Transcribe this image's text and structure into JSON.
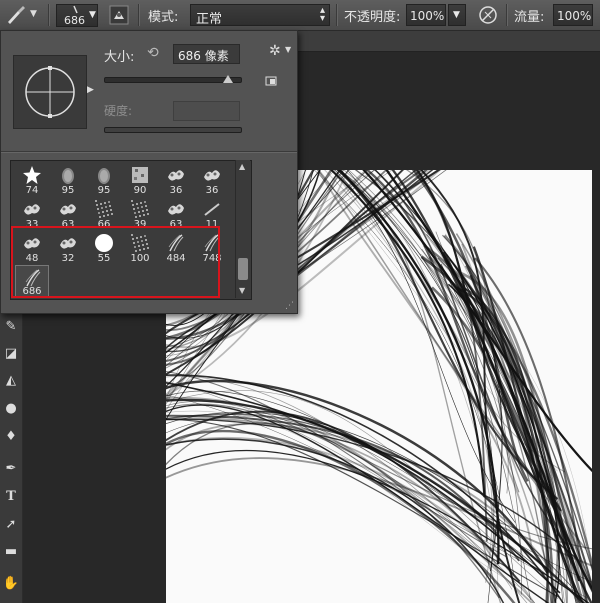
{
  "options_bar": {
    "brush_size": "686",
    "mode_label": "模式:",
    "mode_value": "正常",
    "opacity_label": "不透明度:",
    "opacity_value": "100%",
    "flow_label": "流量:",
    "flow_value": "100%"
  },
  "brush_panel": {
    "size_label": "大小:",
    "size_value": "686 像素",
    "hardness_label": "硬度:",
    "hardness_value": ""
  },
  "brushes": [
    {
      "size": "74",
      "icon": "star-brush-icon"
    },
    {
      "size": "95",
      "icon": "soft-drop-brush-icon"
    },
    {
      "size": "95",
      "icon": "soft-drop-brush-icon"
    },
    {
      "size": "90",
      "icon": "texture-brush-icon"
    },
    {
      "size": "36",
      "icon": "scatter-brush-icon"
    },
    {
      "size": "36",
      "icon": "scatter-brush-icon"
    },
    {
      "size": "33",
      "icon": "scatter-brush-icon"
    },
    {
      "size": "63",
      "icon": "scatter-brush-icon"
    },
    {
      "size": "66",
      "icon": "dust-brush-icon"
    },
    {
      "size": "39",
      "icon": "dust-brush-icon"
    },
    {
      "size": "63",
      "icon": "scatter-brush-icon"
    },
    {
      "size": "11",
      "icon": "stroke-brush-icon"
    },
    {
      "size": "48",
      "icon": "scatter-brush-icon"
    },
    {
      "size": "32",
      "icon": "scatter-brush-icon"
    },
    {
      "size": "55",
      "icon": "round-hard-brush-icon"
    },
    {
      "size": "100",
      "icon": "dust-brush-icon"
    },
    {
      "size": "484",
      "icon": "hair-brush-icon"
    },
    {
      "size": "748",
      "icon": "hair-brush-icon"
    },
    {
      "size": "686",
      "icon": "hair-brush-icon"
    }
  ],
  "selected_brush_size": "686",
  "highlight_color": "#d8141c"
}
